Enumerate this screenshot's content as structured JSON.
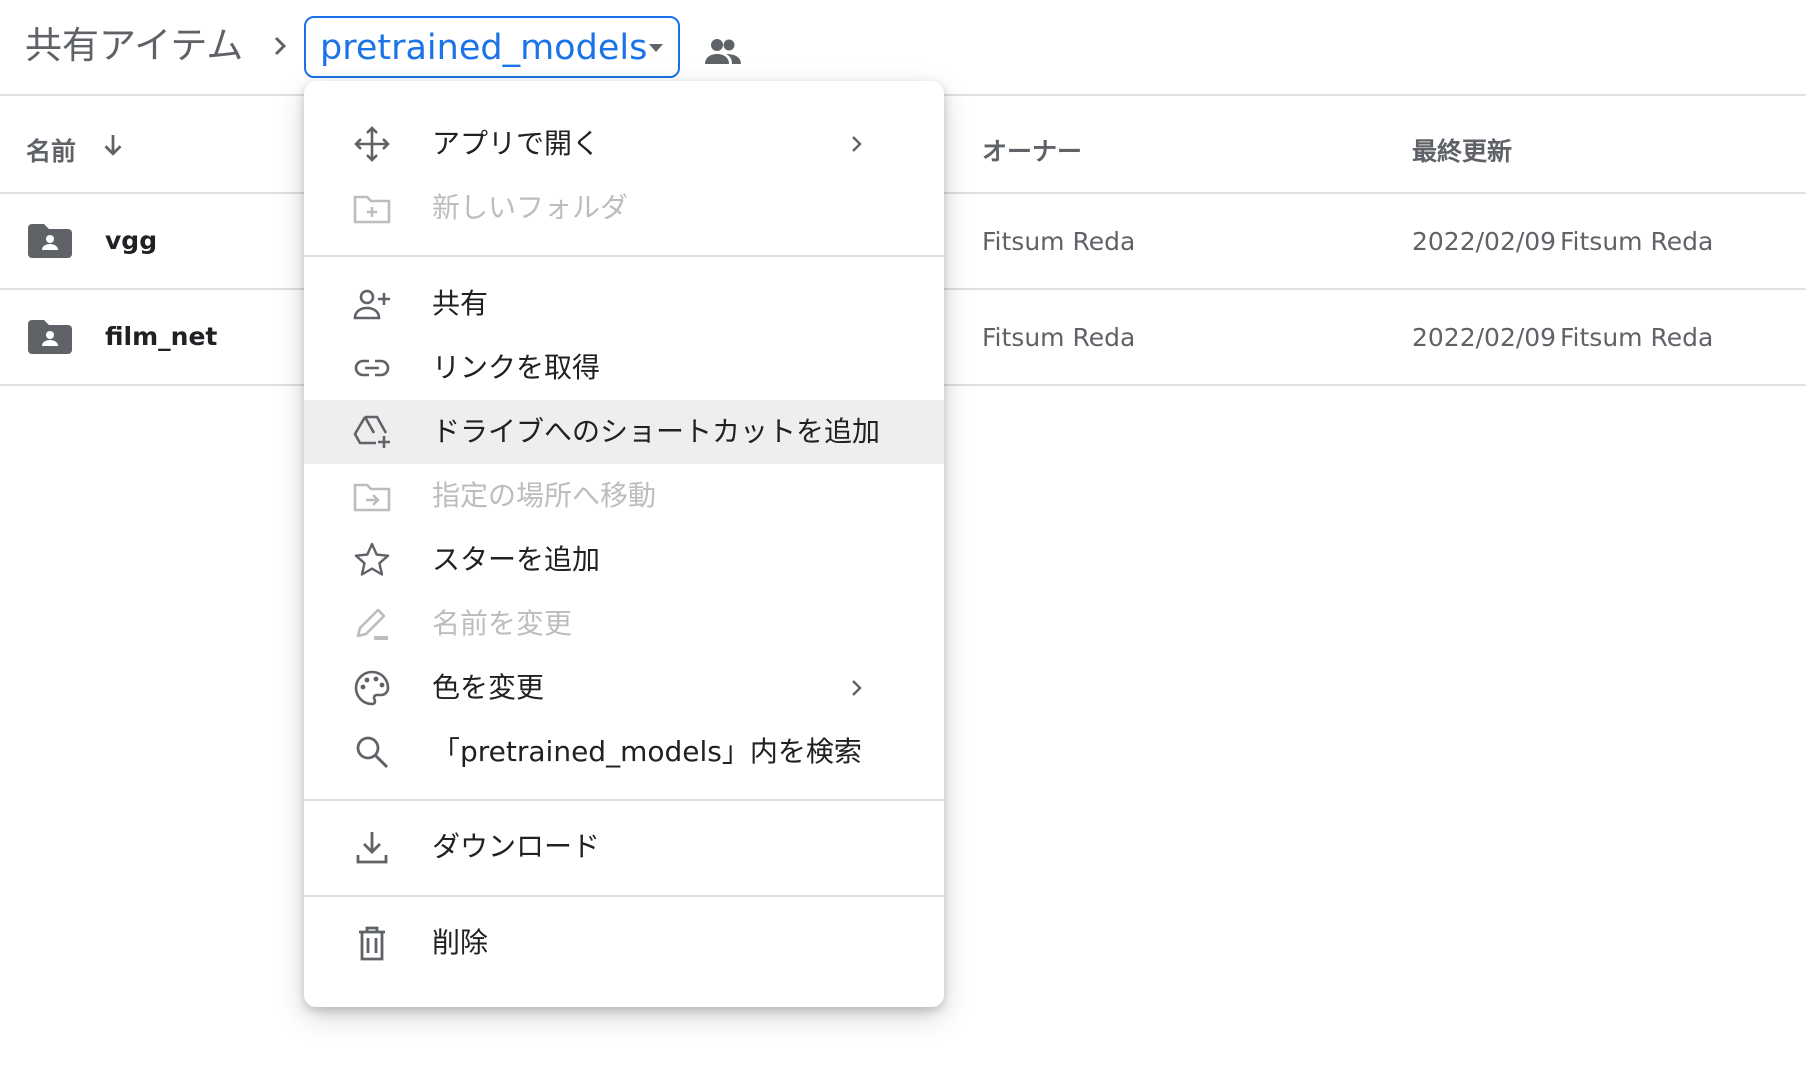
{
  "breadcrumb": {
    "root_label": "共有アイテム",
    "current_label": "pretrained_models"
  },
  "list": {
    "header": {
      "name": "名前",
      "owner": "オーナー",
      "modified": "最終更新"
    },
    "rows": [
      {
        "name": "vgg",
        "owner": "Fitsum Reda",
        "modified_date": "2022/02/09",
        "modified_by": "Fitsum Reda"
      },
      {
        "name": "film_net",
        "owner": "Fitsum Reda",
        "modified_date": "2022/02/09",
        "modified_by": "Fitsum Reda"
      }
    ]
  },
  "menu": {
    "items": [
      {
        "label": "アプリで開く",
        "icon": "open-with-icon",
        "enabled": true,
        "submenu": true
      },
      {
        "label": "新しいフォルダ",
        "icon": "new-folder-icon",
        "enabled": false
      },
      {
        "label": "共有",
        "icon": "person-add-icon",
        "enabled": true
      },
      {
        "label": "リンクを取得",
        "icon": "link-icon",
        "enabled": true
      },
      {
        "label": "ドライブへのショートカットを追加",
        "icon": "drive-shortcut-icon",
        "enabled": true,
        "highlighted": true
      },
      {
        "label": "指定の場所へ移動",
        "icon": "move-folder-icon",
        "enabled": false
      },
      {
        "label": "スターを追加",
        "icon": "star-icon",
        "enabled": true
      },
      {
        "label": "名前を変更",
        "icon": "rename-icon",
        "enabled": false
      },
      {
        "label": "色を変更",
        "icon": "palette-icon",
        "enabled": true,
        "submenu": true
      },
      {
        "label": "「pretrained_models」内を検索",
        "icon": "search-icon",
        "enabled": true
      },
      {
        "label": "ダウンロード",
        "icon": "download-icon",
        "enabled": true
      },
      {
        "label": "削除",
        "icon": "trash-icon",
        "enabled": true
      }
    ]
  },
  "colors": {
    "accent": "#1a73e8",
    "icon": "#5f6368",
    "disabled": "#bdbdbd",
    "highlight": "#eeeeee"
  }
}
